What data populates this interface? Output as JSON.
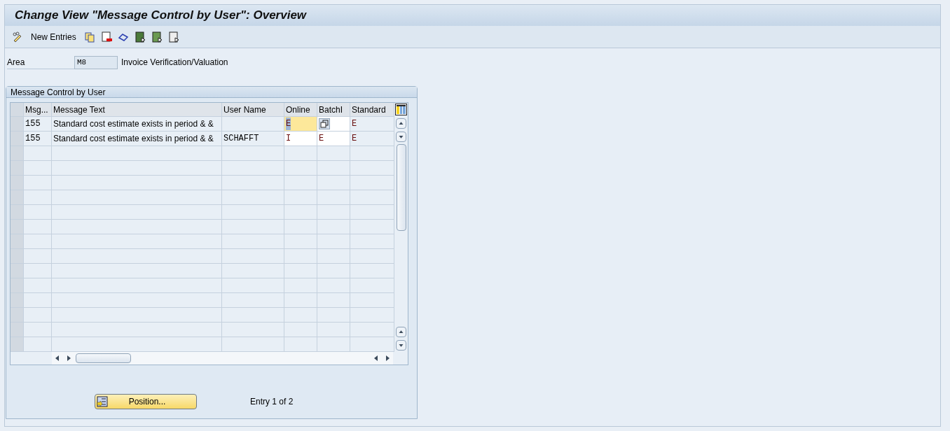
{
  "window": {
    "title": "Change View \"Message Control by User\": Overview"
  },
  "toolbar": {
    "new_entries": "New Entries"
  },
  "area": {
    "label": "Area",
    "value": "M8",
    "description": "Invoice Verification/Valuation"
  },
  "group": {
    "title": "Message Control by User",
    "table": {
      "columns": [
        "Msg...",
        "Message Text",
        "User Name",
        "Online",
        "BatchI",
        "Standard"
      ],
      "rows": [
        {
          "msg": "155",
          "text": "Standard cost estimate exists in period & &",
          "user": "",
          "online": "E",
          "online_focused": true,
          "batch": "",
          "batch_value_help": true,
          "standard": "E"
        },
        {
          "msg": "155",
          "text": "Standard cost estimate exists in period & &",
          "user": "SCHAFFT",
          "online": "I",
          "online_focused": false,
          "batch": "E",
          "batch_value_help": false,
          "standard": "E"
        }
      ]
    }
  },
  "footer": {
    "position_button": "Position...",
    "entry_info": "Entry 1 of 2"
  }
}
